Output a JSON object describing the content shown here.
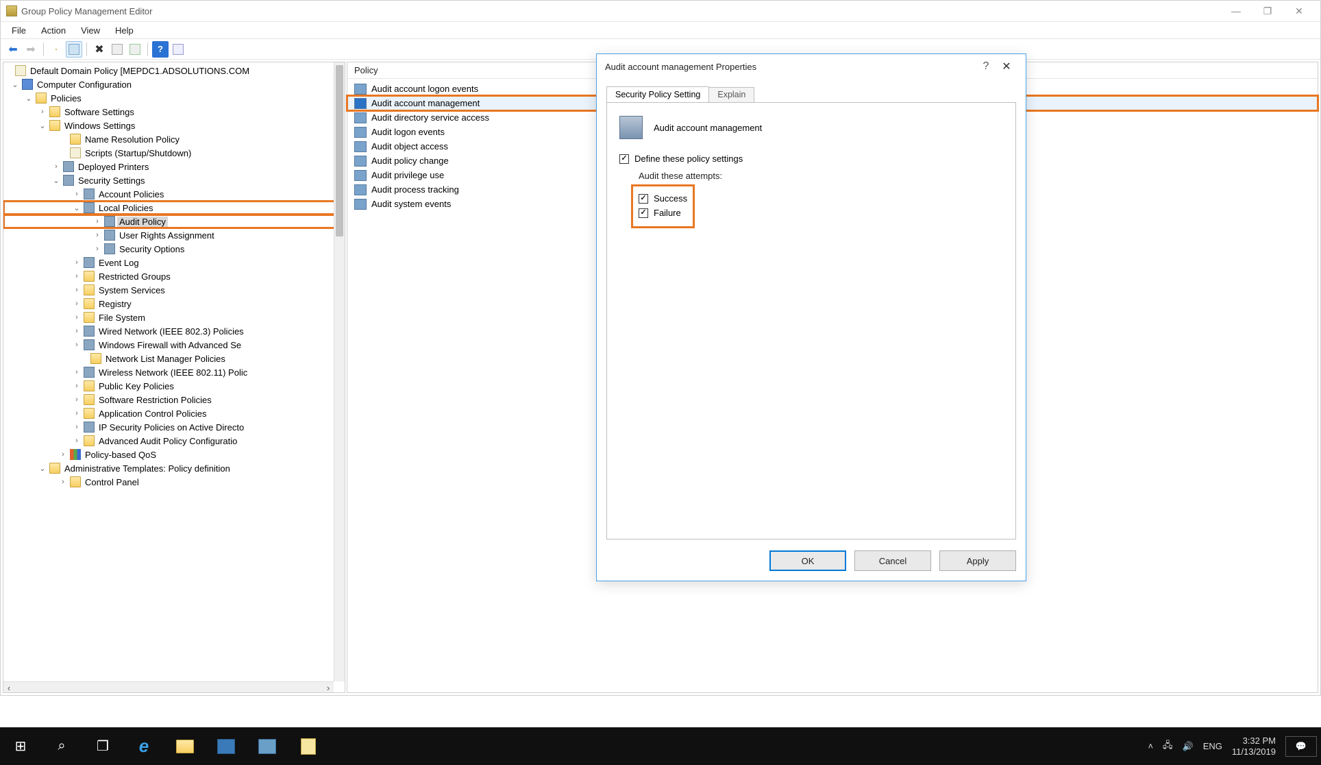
{
  "window": {
    "title": "Group Policy Management Editor",
    "menus": [
      "File",
      "Action",
      "View",
      "Help"
    ]
  },
  "tree": {
    "root": "Default Domain Policy [MEPDC1.ADSOLUTIONS.COM",
    "computer_config": "Computer Configuration",
    "policies": "Policies",
    "software_settings": "Software Settings",
    "windows_settings": "Windows Settings",
    "name_resolution": "Name Resolution Policy",
    "scripts": "Scripts (Startup/Shutdown)",
    "deployed_printers": "Deployed Printers",
    "security_settings": "Security Settings",
    "account_policies": "Account Policies",
    "local_policies": "Local Policies",
    "audit_policy": "Audit Policy",
    "user_rights": "User Rights Assignment",
    "security_options": "Security Options",
    "event_log": "Event Log",
    "restricted_groups": "Restricted Groups",
    "system_services": "System Services",
    "registry": "Registry",
    "file_system": "File System",
    "wired_network": "Wired Network (IEEE 802.3) Policies",
    "windows_firewall": "Windows Firewall with Advanced Se",
    "network_list": "Network List Manager Policies",
    "wireless_network": "Wireless Network (IEEE 802.11) Polic",
    "public_key": "Public Key Policies",
    "software_restriction": "Software Restriction Policies",
    "application_control": "Application Control Policies",
    "ip_security": "IP Security Policies on Active Directo",
    "advanced_audit": "Advanced Audit Policy Configuratio",
    "policy_qos": "Policy-based QoS",
    "admin_templates": "Administrative Templates: Policy definition",
    "control_panel": "Control Panel"
  },
  "list": {
    "header": "Policy",
    "items": [
      "Audit account logon events",
      "Audit account management",
      "Audit directory service access",
      "Audit logon events",
      "Audit object access",
      "Audit policy change",
      "Audit privilege use",
      "Audit process tracking",
      "Audit system events"
    ]
  },
  "dialog": {
    "title": "Audit account management Properties",
    "tab_active": "Security Policy Setting",
    "tab_other": "Explain",
    "heading": "Audit account management",
    "define_label": "Define these policy settings",
    "attempts_label": "Audit these attempts:",
    "success": "Success",
    "failure": "Failure",
    "ok": "OK",
    "cancel": "Cancel",
    "apply": "Apply"
  },
  "taskbar": {
    "lang": "ENG",
    "time": "3:32 PM",
    "date": "11/13/2019"
  }
}
